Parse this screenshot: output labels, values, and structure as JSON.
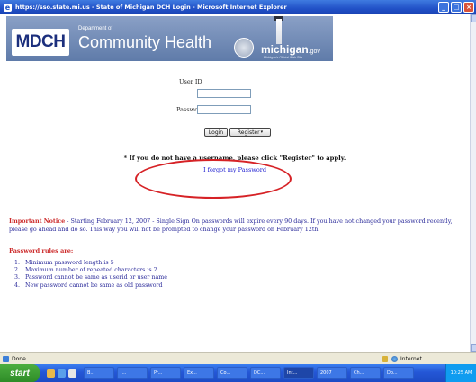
{
  "window": {
    "title": "https://sso.state.mi.us - State of Michigan DCH Login - Microsoft Internet Explorer"
  },
  "banner": {
    "logo_text": "MDCH",
    "department_label": "Department of",
    "department_name": "Community Health",
    "michigan_logo": "michigan",
    "michigan_suffix": ".gov",
    "michigan_tagline": "Michigan's Official Web Site"
  },
  "form": {
    "user_id_label": "User ID",
    "password_label": "Password",
    "login_button": "Login",
    "register_button": "Register"
  },
  "notice": {
    "register_hint": "* If you do not have a username, please click \"Register\" to apply.",
    "forgot_link": "I forgot my Password",
    "important_label": "Important Notice",
    "important_text": " - Starting February 12, 2007 - Single Sign On passwords will expire every 90 days. If you have not changed your password recently, please go ahead and do so. This way you will not be prompted to change your password on February 12th."
  },
  "rules": {
    "heading": "Password rules are:",
    "items": [
      {
        "num": "1.",
        "text": "Minimum password length is 5"
      },
      {
        "num": "2.",
        "text": "Maximum number of repeated characters is 2"
      },
      {
        "num": "3.",
        "text": "Password cannot be same as userid or user name"
      },
      {
        "num": "4.",
        "text": "New password cannot be same as old password"
      }
    ]
  },
  "statusbar": {
    "status": "Done",
    "zone": "Internet"
  },
  "taskbar": {
    "start": "start",
    "tasks": [
      "B...",
      "I...",
      "Pr...",
      "Ex...",
      "Co...",
      "DC...",
      "Int...",
      "2007",
      "Ch...",
      "Do..."
    ],
    "clock": "10:25 AM"
  },
  "colors": {
    "title_blue": "#2151c7",
    "notice_red": "#cc2a2a",
    "link_blue": "#1c1cd0",
    "highlight_ellipse": "#d62226"
  },
  "icons": {
    "browser": "ie-icon",
    "security": "lock-icon",
    "zone": "globe-icon"
  }
}
